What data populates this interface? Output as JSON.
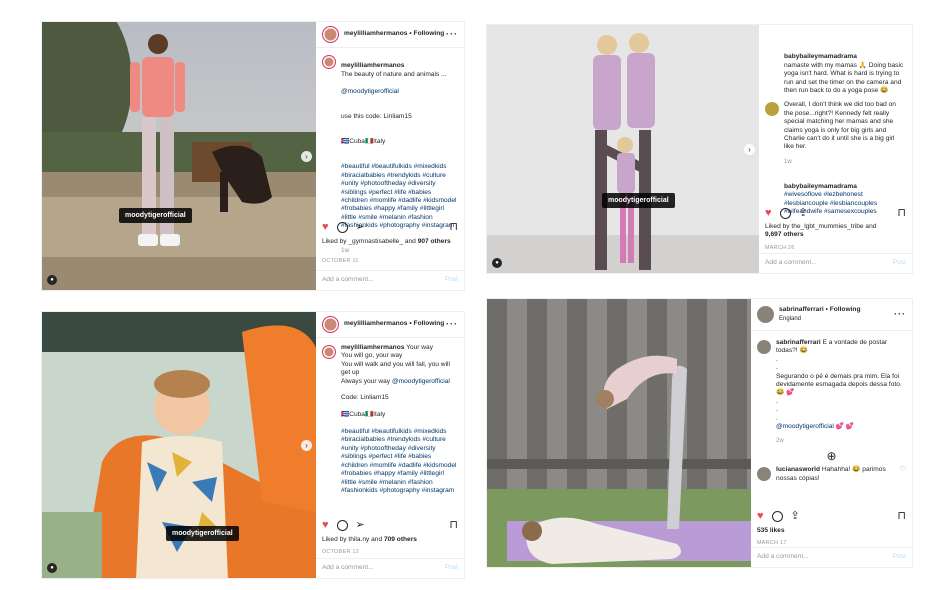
{
  "posts": [
    {
      "user": "meylilliamhermanos",
      "follow": "• Following",
      "caption_user": "meylilliamhermanos",
      "caption": "The beauty of nature and animals ...",
      "mention": "@moodytigerofficial",
      "code": "use this code: Linliam15",
      "location": "🇨🇺Cuba🇮🇹Italy",
      "hashtags": "#beautiful #beautifulkids #mixedkids #biracialbabies #trendykids #culture #unity #photooftheday #diversity #siblings #perfect #life #babies #children #momlife #dadlife #kidsmodel #frobabies #happy #family #littlegirl #little #smile #melanin #fashion #fashionkids #photography #instagram",
      "time": "1w",
      "liked_by": "Liked by _gymnastisabelle_ and",
      "others": "907 others",
      "date": "OCTOBER 11",
      "badge": "moodytigerofficial",
      "add_comment": "Add a comment...",
      "post_btn": "Post"
    },
    {
      "c1_user": "babybaileymamadrama",
      "c1_text": "namaste with my mamas 🙏 Doing basic yoga isn't hard. What is hard is trying to run and set the timer on the camera and then run back to do a yoga pose 😂",
      "c2_text": "Overall, I don't think we did too bad on the pose...right?! Kennedy felt really special matching her mamas and she claims yoga is only for big girls and Charlie can't do it until she is a big girl like her.",
      "c2_time": "1w",
      "c3_user": "babybaileymamadrama",
      "c3_text": "#wivesoflove #lezbehonest #lesbiancouple #lesbiancouples #wifeandwife #samesexcouples",
      "liked_by": "Liked by the_lgbt_mummies_tribe and",
      "others": "9,697 others",
      "date": "MARCH 26",
      "badge": "moodytigerofficial",
      "add_comment": "Add a comment...",
      "post_btn": "Post"
    },
    {
      "user": "meylilliamhermanos",
      "follow": "• Following",
      "caption_user": "meylilliamhermanos",
      "caption": "Your way\nYou will go, your way\nYou will walk and you will fall, you will get up\nAlways your way",
      "mention": "@moodytigerofficial",
      "code": "Code: Linliam15",
      "location": "🇨🇺Cuba🇮🇹Italy",
      "hashtags": "#beautiful #beautifulkids #mixedkids #biracialbabies #trendykids #culture #unity #photooftheday #diversity #siblings #perfect #life #babies #children #momlife #dadlife #kidsmodel #frobabies #happy #family #littlegirl #little #smile #melanin #fashion #fashionkids #photography #instagram",
      "liked_by": "Liked by thila.ny and",
      "others": "709 others",
      "date": "OCTOBER 12",
      "badge": "moodytigerofficial",
      "add_comment": "Add a comment...",
      "post_btn": "Post"
    },
    {
      "user": "sabrinafferrari",
      "follow": "• Following",
      "location": "England",
      "caption_user": "sabrinafferrari",
      "caption": "E a vontade de postar todas?! 😂\n.\n.\nSegurando o pé é demais pra mim. Ela foi devidamente esmagada depois dessa foto.😂 💕\n.\n.\n.",
      "mention": "@moodytigerofficial",
      "mention_tail": "💕 💕",
      "time": "2w",
      "load_more": "⊕",
      "c_user": "lucianasworld",
      "c_text": "Hahahha! 😂 parimos nossas cópias!",
      "likes": "535 likes",
      "date": "MARCH 17",
      "add_comment": "Add a comment...",
      "post_btn": "Post"
    }
  ],
  "colors": {
    "accent": "#e1306c",
    "heart": "#ed4956",
    "link": "#003569",
    "muted": "#999999"
  }
}
